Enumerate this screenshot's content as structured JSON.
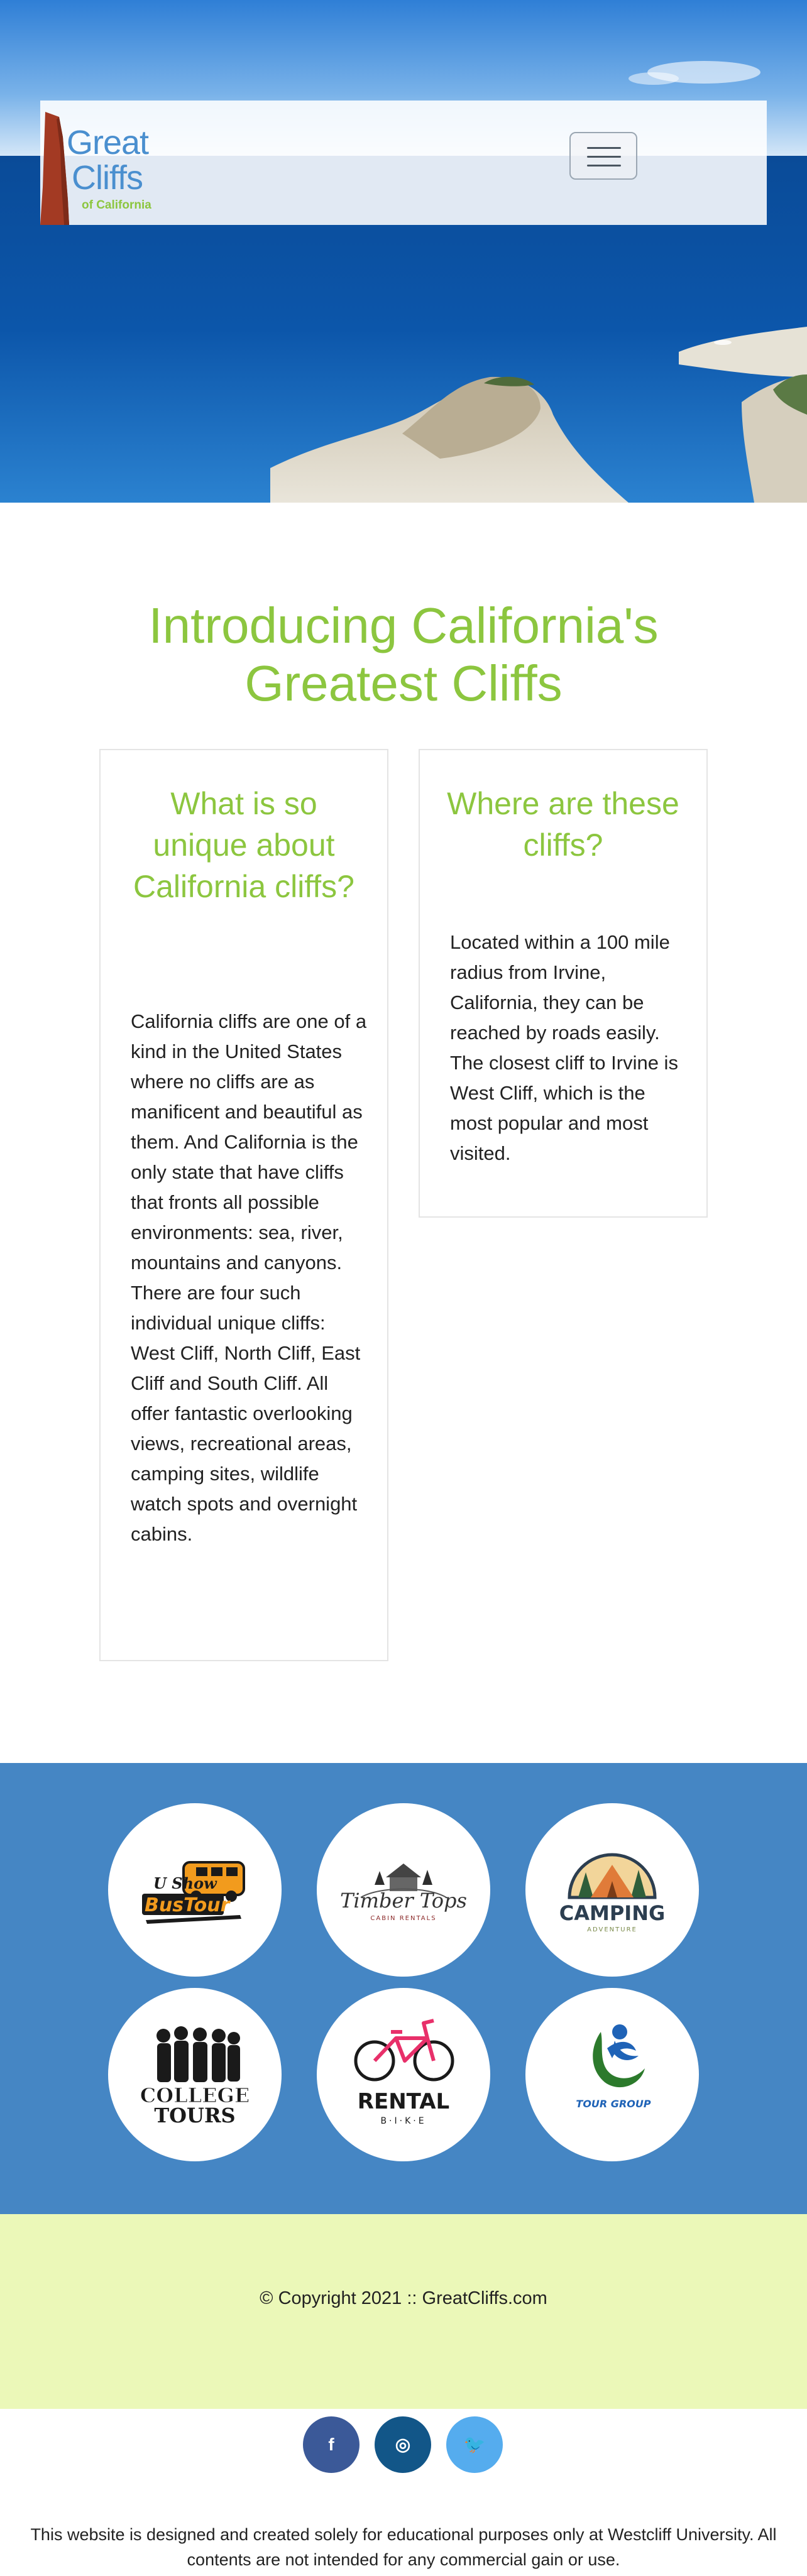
{
  "header": {
    "logo": {
      "line1": "Great",
      "line2": "Cliffs",
      "line3": "of California"
    },
    "menu_icon": "hamburger-icon"
  },
  "main": {
    "title": "Introducing California's Greatest Cliffs",
    "cards": [
      {
        "heading": "What is so unique about California cliffs?",
        "body": "California cliffs are one of a kind in the United States where no cliffs are as manificent and beautiful as them. And California is the only state that have cliffs that fronts all possible environments: sea, river, mountains and canyons. There are four such individual unique cliffs: West Cliff, North Cliff, East Cliff and South Cliff. All offer fantastic overlooking views, recreational areas, camping sites, wildlife watch spots and overnight cabins."
      },
      {
        "heading": "Where are these cliffs?",
        "body": "Located within a 100 mile radius from Irvine, California, they can be reached by roads easily. The closest cliff to Irvine is West Cliff, which is the most popular and most visited."
      }
    ]
  },
  "partners": [
    {
      "name": "bus-tour-logo",
      "line1": "U Show",
      "line2": "BusTour"
    },
    {
      "name": "timber-tops-logo",
      "line1": "Timber Tops",
      "line2": "CABIN RENTALS"
    },
    {
      "name": "camping-logo",
      "line1": "CAMPING",
      "line2": "ADVENTURE"
    },
    {
      "name": "college-tours-logo",
      "line1": "COLLEGE",
      "line2": "TOURS"
    },
    {
      "name": "rental-bike-logo",
      "line1": "RENTAL",
      "line2": "B·I·K·E"
    },
    {
      "name": "tour-group-logo",
      "line1": "TOUR GROUP"
    }
  ],
  "footer": {
    "copyright": "© Copyright 2021 :: GreatCliffs.com",
    "social": [
      {
        "label": "f",
        "icon": "facebook-icon",
        "color": "#3b5998"
      },
      {
        "label": "◎",
        "icon": "instagram-icon",
        "color": "#125688"
      },
      {
        "label": "🐦",
        "icon": "twitter-icon",
        "color": "#55acee"
      }
    ],
    "disclaimer": "This website is designed and created solely for educational purposes only at Westcliff University. All contents are not intended for any commercial gain or use."
  },
  "colors": {
    "accent_green": "#8cc63f",
    "partner_band": "#4586c4",
    "footer_band": "#ebf8b8",
    "logo_blue": "#4a8fcf"
  }
}
